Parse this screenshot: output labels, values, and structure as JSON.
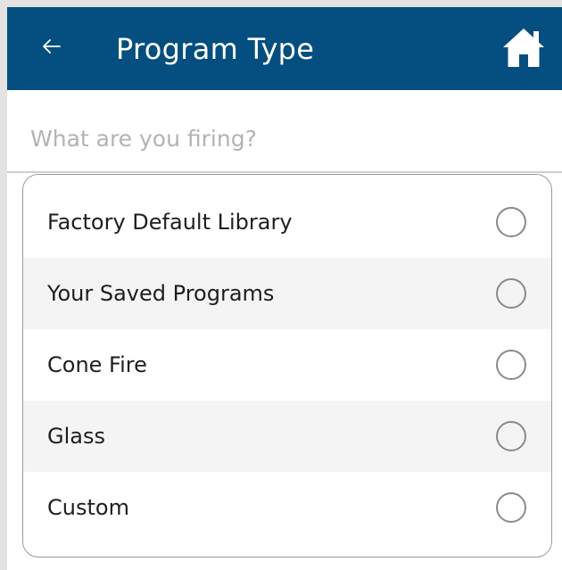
{
  "header": {
    "title": "Program Type",
    "back_icon": "back-arrow-icon",
    "home_icon": "home-icon",
    "background_color": "#044f7f",
    "text_color": "#ffffff"
  },
  "prompt": {
    "text": "What are you firing?"
  },
  "options": [
    {
      "label": "Factory Default Library",
      "selected": false
    },
    {
      "label": "Your Saved Programs",
      "selected": false
    },
    {
      "label": "Cone Fire",
      "selected": false
    },
    {
      "label": "Glass",
      "selected": false
    },
    {
      "label": "Custom",
      "selected": false
    }
  ]
}
